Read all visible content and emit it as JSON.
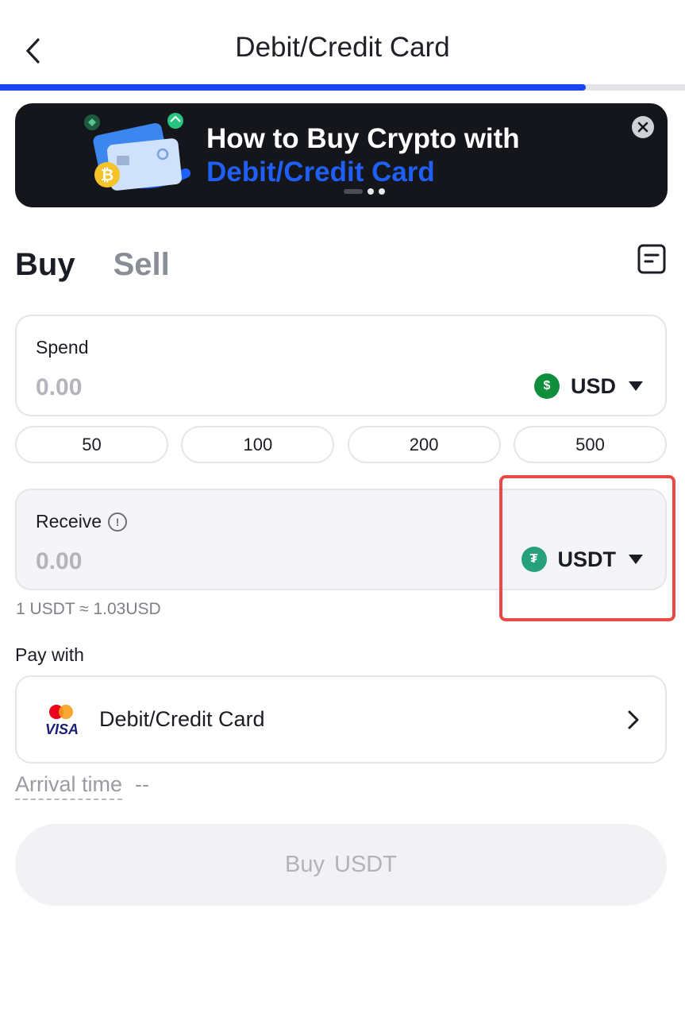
{
  "header": {
    "title": "Debit/Credit Card",
    "back_icon": "chevron-left-icon",
    "progress": 0.855
  },
  "banner": {
    "title": "How to Buy Crypto with",
    "subtitle": "Debit/Credit Card",
    "close_icon": "close-icon",
    "slide_count": 3,
    "active_slide": 1
  },
  "tabs": [
    {
      "label": "Buy",
      "active": true
    },
    {
      "label": "Sell",
      "active": false
    }
  ],
  "orders_icon": "order-history-icon",
  "spend": {
    "label": "Spend",
    "placeholder": "0.00",
    "currency": "USD",
    "currency_symbol": "$"
  },
  "quick_amounts": [
    "50",
    "100",
    "200",
    "500"
  ],
  "receive": {
    "label": "Receive",
    "placeholder": "0.00",
    "currency": "USDT",
    "currency_symbol": "₮"
  },
  "rate": "1 USDT ≈ 1.03USD",
  "pay_with": {
    "label": "Pay with",
    "method": "Debit/Credit Card",
    "logo_text": "VISA"
  },
  "arrival": {
    "label": "Arrival time",
    "value": "--"
  },
  "buy_button": {
    "action": "Buy",
    "asset": "USDT"
  },
  "colors": {
    "accent": "#1a44f2",
    "banner_bg": "#14161c",
    "usd_coin": "#0f8f3b",
    "usdt_coin": "#26a17b",
    "highlight": "#ea4a47"
  }
}
